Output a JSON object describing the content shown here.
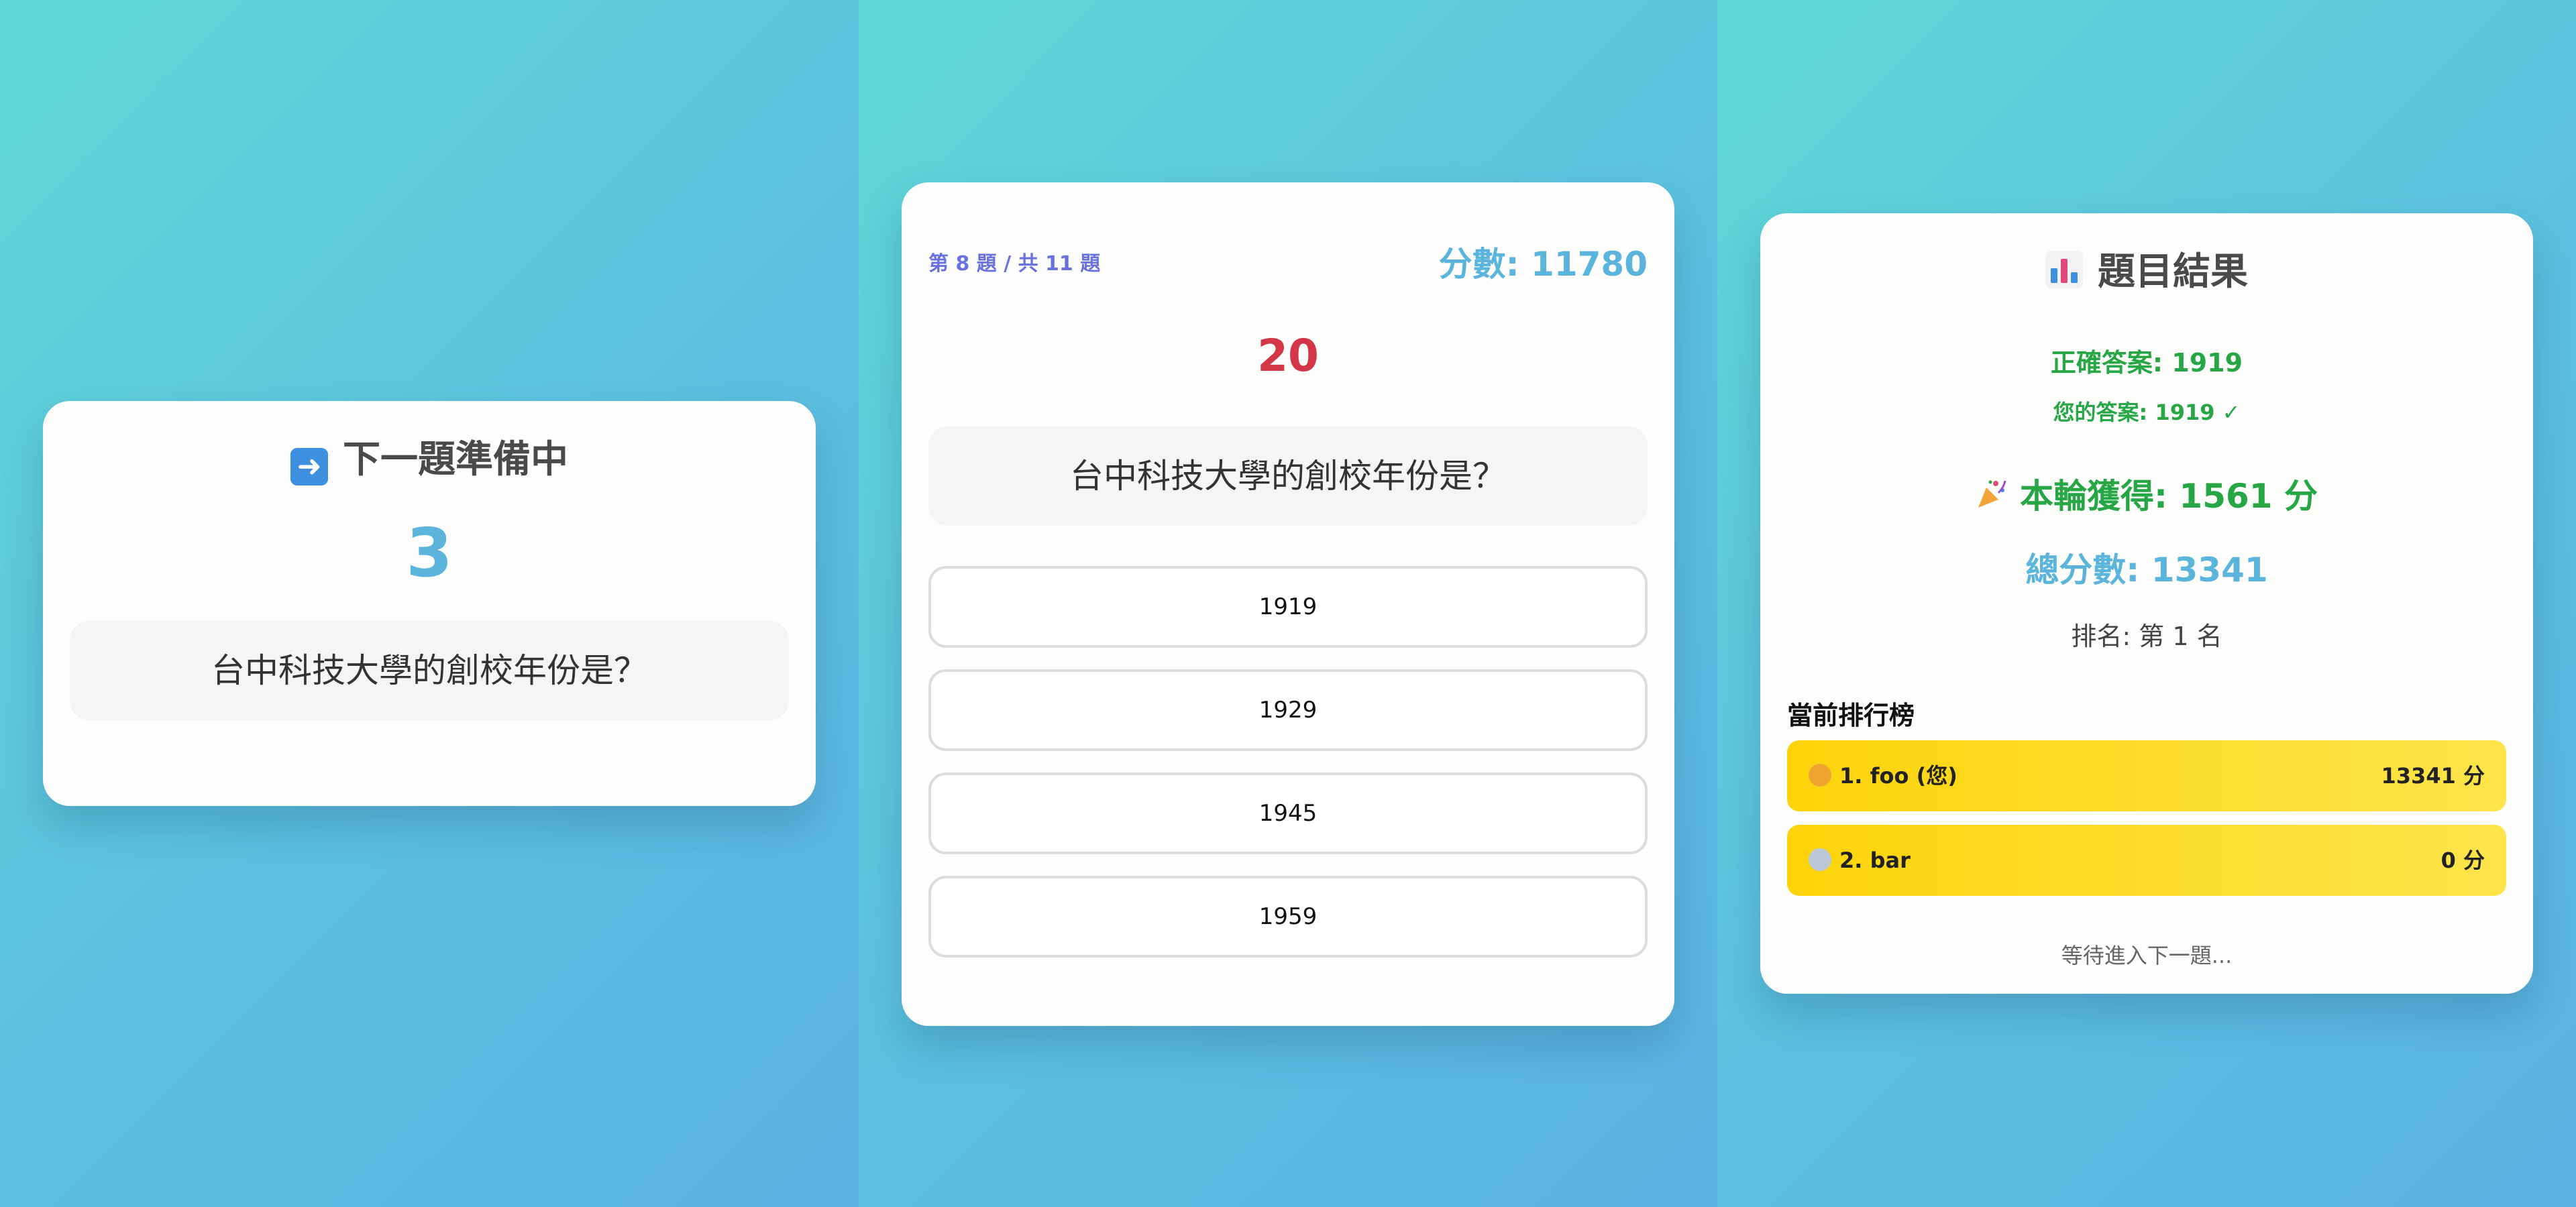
{
  "panel1": {
    "title_icon": "right-arrow-icon",
    "title": "下一題準備中",
    "countdown": "3",
    "question": "台中科技大學的創校年份是？"
  },
  "panel2": {
    "progress": "第 8 題 / 共 11 題",
    "score": "分數: 11780",
    "timer": "20",
    "question": "台中科技大學的創校年份是？",
    "options": [
      "1919",
      "1929",
      "1945",
      "1959"
    ]
  },
  "panel3": {
    "title_icon": "bar-chart-icon",
    "title": "題目結果",
    "correct_answer": "正確答案: 1919",
    "your_answer": "您的答案: 1919 ✓",
    "round_gain_icon": "party-popper-icon",
    "round_gain": "本輪獲得: 1561 分",
    "total_score": "總分數: 13341",
    "rank": "排名: 第 1 名",
    "leaderboard_title": "當前排行榜",
    "leaderboard": [
      {
        "name": "1. foo (您)",
        "points": "13341 分",
        "medal": "gold-medal-icon"
      },
      {
        "name": "2. bar",
        "points": "0 分",
        "medal": "silver-medal-icon"
      }
    ],
    "waiting": "等待進入下一題..."
  },
  "colors": {
    "accent_blue": "#5ab4dc",
    "timer_red": "#d33646",
    "success_green": "#27a645",
    "progress_purple": "#6a72e0",
    "leaderboard_yellow": "#fdd40a"
  }
}
